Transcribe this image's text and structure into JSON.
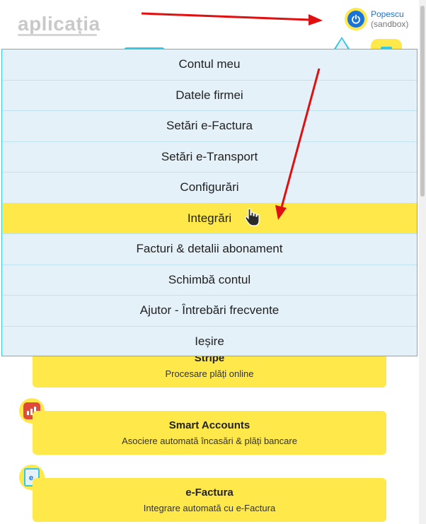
{
  "header": {
    "logo_text": "aplicația",
    "user_name": "Popescu",
    "user_mode": "(sandbox)"
  },
  "dropdown": {
    "items": [
      {
        "label": "Contul meu"
      },
      {
        "label": "Datele firmei"
      },
      {
        "label": "Setări e-Factura"
      },
      {
        "label": "Setări e-Transport"
      },
      {
        "label": "Configurări"
      },
      {
        "label": "Integrări",
        "active": true
      },
      {
        "label": "Facturi & detalii abonament"
      },
      {
        "label": "Schimbă contul"
      },
      {
        "label": "Ajutor - Întrebări frecvente"
      },
      {
        "label": "Ieșire"
      }
    ]
  },
  "cards": [
    {
      "title": "Stripe",
      "subtitle": "Procesare plăți online"
    },
    {
      "title": "Smart Accounts",
      "subtitle": "Asociere automată încasări & plăți bancare"
    },
    {
      "title": "e-Factura",
      "subtitle": "Integrare automată cu e-Factura"
    }
  ],
  "colors": {
    "accent_yellow": "#ffe84a",
    "accent_cyan": "#36c7e3",
    "dropdown_bg": "#e4f1f8",
    "link_blue": "#1a73d9",
    "annotation_red": "#e01010"
  }
}
